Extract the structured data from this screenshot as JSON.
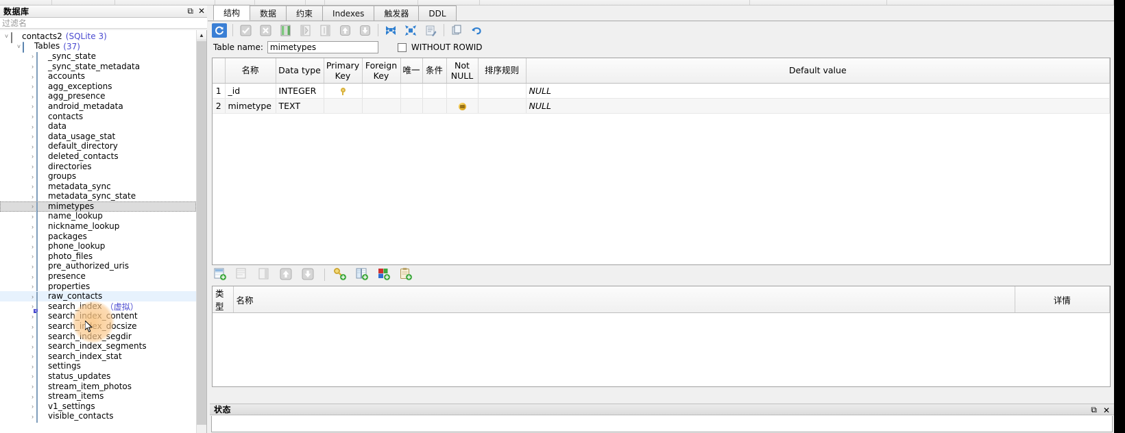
{
  "window": {
    "right_black_strip": true
  },
  "sidebar": {
    "title": "数据库",
    "float_icon": "float-icon",
    "close_icon": "close-icon",
    "filter": {
      "value": "",
      "placeholder": "过滤名"
    },
    "tree": [
      {
        "label": "contacts2",
        "suffix": "(SQLite 3)",
        "icon": "database-icon",
        "level": 0,
        "expander": "chevron-down",
        "state": "normal"
      },
      {
        "label": "Tables",
        "suffix": "(37)",
        "icon": "folder-icon",
        "level": 1,
        "expander": "chevron-down",
        "state": "normal"
      },
      {
        "label": "_sync_state",
        "suffix": "",
        "icon": "table-icon",
        "level": 2,
        "expander": "chevron-right",
        "state": "normal"
      },
      {
        "label": "_sync_state_metadata",
        "suffix": "",
        "icon": "table-icon",
        "level": 2,
        "expander": "chevron-right",
        "state": "normal"
      },
      {
        "label": "accounts",
        "suffix": "",
        "icon": "table-icon",
        "level": 2,
        "expander": "chevron-right",
        "state": "normal"
      },
      {
        "label": "agg_exceptions",
        "suffix": "",
        "icon": "table-icon",
        "level": 2,
        "expander": "chevron-right",
        "state": "normal"
      },
      {
        "label": "agg_presence",
        "suffix": "",
        "icon": "table-icon",
        "level": 2,
        "expander": "chevron-right",
        "state": "normal"
      },
      {
        "label": "android_metadata",
        "suffix": "",
        "icon": "table-icon",
        "level": 2,
        "expander": "chevron-right",
        "state": "normal"
      },
      {
        "label": "contacts",
        "suffix": "",
        "icon": "table-icon",
        "level": 2,
        "expander": "chevron-right",
        "state": "normal"
      },
      {
        "label": "data",
        "suffix": "",
        "icon": "table-icon",
        "level": 2,
        "expander": "chevron-right",
        "state": "normal"
      },
      {
        "label": "data_usage_stat",
        "suffix": "",
        "icon": "table-icon",
        "level": 2,
        "expander": "chevron-right",
        "state": "normal"
      },
      {
        "label": "default_directory",
        "suffix": "",
        "icon": "table-icon",
        "level": 2,
        "expander": "chevron-right",
        "state": "normal"
      },
      {
        "label": "deleted_contacts",
        "suffix": "",
        "icon": "table-icon",
        "level": 2,
        "expander": "chevron-right",
        "state": "normal"
      },
      {
        "label": "directories",
        "suffix": "",
        "icon": "table-icon",
        "level": 2,
        "expander": "chevron-right",
        "state": "normal"
      },
      {
        "label": "groups",
        "suffix": "",
        "icon": "table-icon",
        "level": 2,
        "expander": "chevron-right",
        "state": "normal"
      },
      {
        "label": "metadata_sync",
        "suffix": "",
        "icon": "table-icon",
        "level": 2,
        "expander": "chevron-right",
        "state": "normal"
      },
      {
        "label": "metadata_sync_state",
        "suffix": "",
        "icon": "table-icon",
        "level": 2,
        "expander": "chevron-right",
        "state": "normal"
      },
      {
        "label": "mimetypes",
        "suffix": "",
        "icon": "table-icon",
        "level": 2,
        "expander": "chevron-right",
        "state": "selected"
      },
      {
        "label": "name_lookup",
        "suffix": "",
        "icon": "table-icon",
        "level": 2,
        "expander": "chevron-right",
        "state": "normal"
      },
      {
        "label": "nickname_lookup",
        "suffix": "",
        "icon": "table-icon",
        "level": 2,
        "expander": "chevron-right",
        "state": "normal"
      },
      {
        "label": "packages",
        "suffix": "",
        "icon": "table-icon",
        "level": 2,
        "expander": "chevron-right",
        "state": "normal"
      },
      {
        "label": "phone_lookup",
        "suffix": "",
        "icon": "table-icon",
        "level": 2,
        "expander": "chevron-right",
        "state": "normal"
      },
      {
        "label": "photo_files",
        "suffix": "",
        "icon": "table-icon",
        "level": 2,
        "expander": "chevron-right",
        "state": "normal"
      },
      {
        "label": "pre_authorized_uris",
        "suffix": "",
        "icon": "table-icon",
        "level": 2,
        "expander": "chevron-right",
        "state": "normal"
      },
      {
        "label": "presence",
        "suffix": "",
        "icon": "table-icon",
        "level": 2,
        "expander": "chevron-right",
        "state": "normal"
      },
      {
        "label": "properties",
        "suffix": "",
        "icon": "table-icon",
        "level": 2,
        "expander": "chevron-right",
        "state": "normal"
      },
      {
        "label": "raw_contacts",
        "suffix": "",
        "icon": "table-icon",
        "level": 2,
        "expander": "chevron-right",
        "state": "hovered"
      },
      {
        "label": "search_index",
        "suffix": "（虚拟）",
        "icon": "view-icon",
        "level": 2,
        "expander": "chevron-right",
        "state": "normal"
      },
      {
        "label": "search_index_content",
        "suffix": "",
        "icon": "table-icon",
        "level": 2,
        "expander": "chevron-right",
        "state": "normal"
      },
      {
        "label": "search_index_docsize",
        "suffix": "",
        "icon": "table-icon",
        "level": 2,
        "expander": "chevron-right",
        "state": "normal"
      },
      {
        "label": "search_index_segdir",
        "suffix": "",
        "icon": "table-icon",
        "level": 2,
        "expander": "chevron-right",
        "state": "normal"
      },
      {
        "label": "search_index_segments",
        "suffix": "",
        "icon": "table-icon",
        "level": 2,
        "expander": "chevron-right",
        "state": "normal"
      },
      {
        "label": "search_index_stat",
        "suffix": "",
        "icon": "table-icon",
        "level": 2,
        "expander": "chevron-right",
        "state": "normal"
      },
      {
        "label": "settings",
        "suffix": "",
        "icon": "table-icon",
        "level": 2,
        "expander": "chevron-right",
        "state": "normal"
      },
      {
        "label": "status_updates",
        "suffix": "",
        "icon": "table-icon",
        "level": 2,
        "expander": "chevron-right",
        "state": "normal"
      },
      {
        "label": "stream_item_photos",
        "suffix": "",
        "icon": "table-icon",
        "level": 2,
        "expander": "chevron-right",
        "state": "normal"
      },
      {
        "label": "stream_items",
        "suffix": "",
        "icon": "table-icon",
        "level": 2,
        "expander": "chevron-right",
        "state": "normal"
      },
      {
        "label": "v1_settings",
        "suffix": "",
        "icon": "table-icon",
        "level": 2,
        "expander": "chevron-right",
        "state": "normal"
      },
      {
        "label": "visible_contacts",
        "suffix": "",
        "icon": "table-icon",
        "level": 2,
        "expander": "chevron-right",
        "state": "normal"
      }
    ]
  },
  "tabs": [
    {
      "label": "结构",
      "active": true
    },
    {
      "label": "数据",
      "active": false
    },
    {
      "label": "约束",
      "active": false
    },
    {
      "label": "Indexes",
      "active": false
    },
    {
      "label": "触发器",
      "active": false
    },
    {
      "label": "DDL",
      "active": false
    }
  ],
  "toolbar": {
    "buttons": [
      {
        "name": "refresh-icon",
        "enabled": true,
        "highlighted": true
      },
      {
        "name": "apply-check-icon",
        "enabled": false,
        "highlighted": false
      },
      {
        "name": "revert-cross-icon",
        "enabled": false,
        "highlighted": false
      },
      {
        "name": "add-column-icon",
        "enabled": true,
        "highlighted": false
      },
      {
        "name": "insert-column-before-icon",
        "enabled": false,
        "highlighted": false
      },
      {
        "name": "insert-column-after-icon",
        "enabled": false,
        "highlighted": false
      },
      {
        "name": "move-up-icon",
        "enabled": false,
        "highlighted": false
      },
      {
        "name": "move-down-icon",
        "enabled": false,
        "highlighted": false
      },
      {
        "name": "collapse-all-icon",
        "enabled": true,
        "highlighted": false
      },
      {
        "name": "expand-all-icon",
        "enabled": true,
        "highlighted": false
      },
      {
        "name": "print-preview-icon",
        "enabled": true,
        "highlighted": false
      },
      {
        "name": "copy-icon",
        "enabled": true,
        "highlighted": false
      },
      {
        "name": "undo-icon",
        "enabled": true,
        "highlighted": false
      }
    ]
  },
  "table_form": {
    "name_label": "Table name:",
    "name_value": "mimetypes",
    "without_rowid_label": "WITHOUT ROWID",
    "without_rowid_checked": false
  },
  "structure_grid": {
    "columns": [
      "名称",
      "Data type",
      "Primary Key",
      "Foreign Key",
      "唯一",
      "条件",
      "Not NULL",
      "排序规则",
      "Default value"
    ],
    "rows": [
      {
        "num": "1",
        "name": "_id",
        "data_type": "INTEGER",
        "primary_key": "key-icon",
        "foreign_key": "",
        "unique": "",
        "check": "",
        "not_null": "",
        "collation": "",
        "default_value": "NULL"
      },
      {
        "num": "2",
        "name": "mimetype",
        "data_type": "TEXT",
        "primary_key": "",
        "foreign_key": "",
        "unique": "",
        "check": "",
        "not_null": "not-null-icon",
        "collation": "",
        "default_value": "NULL"
      }
    ]
  },
  "toolbar2": {
    "buttons": [
      {
        "name": "add-constraint-icon",
        "enabled": true
      },
      {
        "name": "edit-constraint-icon",
        "enabled": false
      },
      {
        "name": "delete-constraint-icon",
        "enabled": false
      },
      {
        "name": "move-up-icon",
        "enabled": false
      },
      {
        "name": "move-down-icon",
        "enabled": false
      },
      {
        "name": "add-primary-key-icon",
        "enabled": true
      },
      {
        "name": "add-foreign-key-icon",
        "enabled": true
      },
      {
        "name": "add-unique-icon",
        "enabled": true
      },
      {
        "name": "add-check-icon",
        "enabled": true
      }
    ]
  },
  "constraints_grid": {
    "columns": [
      "类型",
      "名称",
      "详情"
    ],
    "rows": []
  },
  "status_dock": {
    "title": "状态",
    "float_icon": "float-icon",
    "close_icon": "close-icon",
    "content": ""
  },
  "colors": {
    "accent": "#3a7fd5",
    "virtual_label": "#4a4ad0",
    "selected_row": "#dcdcdc",
    "hovered_row": "#e7f2fd",
    "hotspot": "#fac480"
  }
}
